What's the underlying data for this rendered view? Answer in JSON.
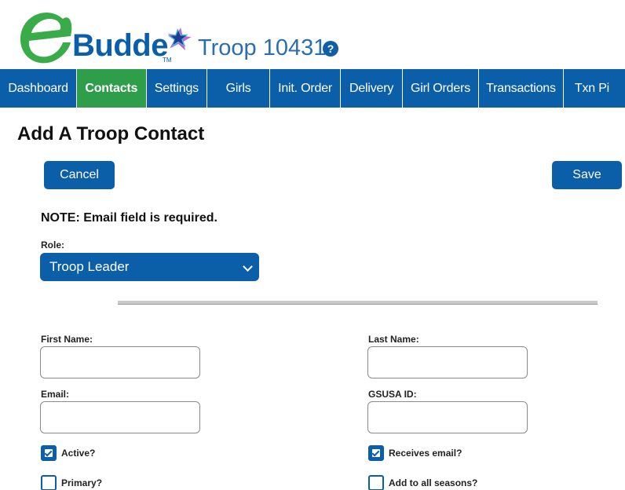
{
  "brand": {
    "logo_text": "Budde",
    "tm": "TM",
    "troop_title": "Troop 10431",
    "help_glyph": "?"
  },
  "nav": [
    {
      "label": "Dashboard",
      "active": false
    },
    {
      "label": "Contacts",
      "active": true
    },
    {
      "label": "Settings",
      "active": false
    },
    {
      "label": "Girls",
      "active": false
    },
    {
      "label": "Init. Order",
      "active": false
    },
    {
      "label": "Delivery",
      "active": false
    },
    {
      "label": "Girl Orders",
      "active": false
    },
    {
      "label": "Transactions",
      "active": false
    },
    {
      "label": "Txn Pi",
      "active": false
    }
  ],
  "page": {
    "title": "Add A Troop Contact",
    "cancel_label": "Cancel",
    "save_label": "Save",
    "note": "NOTE: Email field is required."
  },
  "role": {
    "label": "Role:",
    "value": "Troop Leader"
  },
  "form": {
    "first_name_label": "First Name:",
    "first_name_value": "",
    "last_name_label": "Last Name:",
    "last_name_value": "",
    "email_label": "Email:",
    "email_value": "",
    "gsusa_label": "GSUSA ID:",
    "gsusa_value": ""
  },
  "checks": {
    "active_label": "Active?",
    "active_checked": true,
    "receives_email_label": "Receives email?",
    "receives_email_checked": true,
    "primary_label": "Primary?",
    "primary_checked": false,
    "all_seasons_label": "Add to all seasons?",
    "all_seasons_checked": false
  },
  "colors": {
    "brand_blue": "#0b5ea8",
    "active_green": "#2f9e4a",
    "logo_green": "#3aab49"
  },
  "icons": [
    "help-icon",
    "chevron-down-icon",
    "checkmark-icon",
    "star-icon"
  ]
}
